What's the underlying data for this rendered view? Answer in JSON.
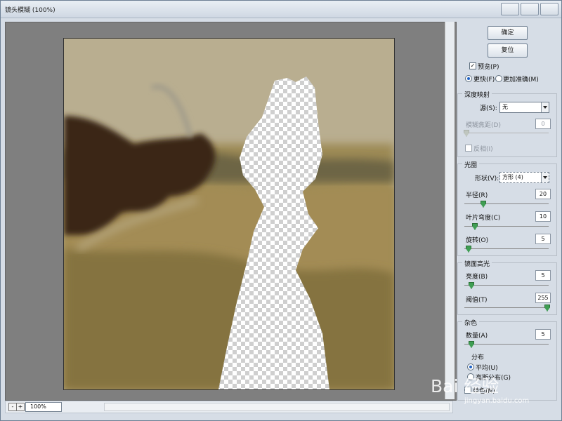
{
  "window": {
    "title": "镜头模糊 (100%)"
  },
  "buttons": {
    "ok": "确定",
    "reset": "复位"
  },
  "options": {
    "preview": "预览(P)",
    "faster": "更快(F)",
    "more_accurate": "更加准确(M)"
  },
  "depth_map": {
    "title": "深度映射",
    "source_label": "源(S):",
    "source_value": "无",
    "blur_focal_label": "模糊焦距(D)",
    "blur_focal_value": "0",
    "invert_label": "反相(I)"
  },
  "iris": {
    "title": "光圈",
    "shape_label": "形状(V):",
    "shape_value": "方形 (4)",
    "radius_label": "半径(R)",
    "radius_value": "20",
    "blade_curvature_label": "叶片弯度(C)",
    "blade_curvature_value": "10",
    "rotation_label": "旋转(O)",
    "rotation_value": "5"
  },
  "specular": {
    "title": "镜面高光",
    "brightness_label": "亮度(B)",
    "brightness_value": "5",
    "threshold_label": "阈值(T)",
    "threshold_value": "255"
  },
  "noise": {
    "title": "杂色",
    "amount_label": "数量(A)",
    "amount_value": "5",
    "distribution_title": "分布",
    "uniform_label": "平均(U)",
    "gaussian_label": "高斯分布(G)",
    "mono_label": "单色(N)"
  },
  "zoom": {
    "value": "100%",
    "minus": "-",
    "plus": "+"
  },
  "watermark": {
    "main": "Bai 经验",
    "sub": "jingyan.baidu.com"
  },
  "sliders": {
    "radius": 0.2,
    "blade": 0.1,
    "rotation": 0.02,
    "brightness": 0.05,
    "threshold": 1.0,
    "amount": 0.05
  }
}
